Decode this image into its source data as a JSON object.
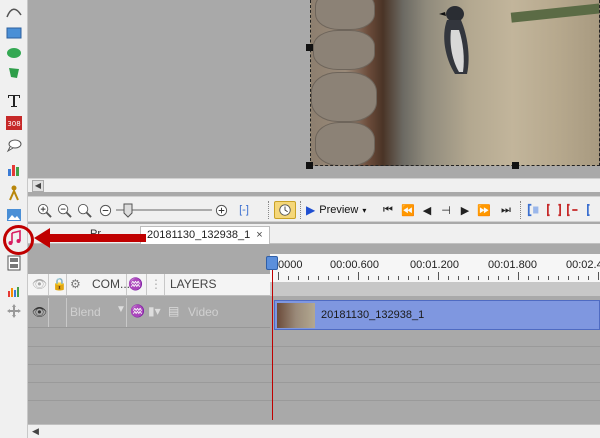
{
  "tools": [
    {
      "name": "curve-tool-icon",
      "glyph": "∿"
    },
    {
      "name": "rectangle-tool-icon",
      "glyph": "▭"
    },
    {
      "name": "ellipse-tool-icon",
      "glyph": "●"
    },
    {
      "name": "shape-tool-icon",
      "glyph": "✱"
    },
    {
      "name": "text-tool-icon",
      "glyph": "T"
    },
    {
      "name": "counter-tool-icon",
      "glyph": "308"
    },
    {
      "name": "callout-tool-icon",
      "glyph": "💬"
    },
    {
      "name": "chart-tool-icon",
      "glyph": "▥"
    },
    {
      "name": "figure-tool-icon",
      "glyph": "♙"
    },
    {
      "name": "image-tool-icon",
      "glyph": "▦"
    },
    {
      "name": "audio-tool-icon",
      "glyph": "♫"
    },
    {
      "name": "filmstrip-tool-icon",
      "glyph": "▤"
    },
    {
      "name": "equalizer-tool-icon",
      "glyph": "▥"
    },
    {
      "name": "move-tool-icon",
      "glyph": "✥"
    }
  ],
  "toolbar": {
    "preview_label": "Preview",
    "fit_label": "[-]"
  },
  "tabs": {
    "previous_label": "Pr",
    "active_label": "20181130_132938_1",
    "close_glyph": "×"
  },
  "layers": {
    "header_composite": "COM...",
    "header_layers": "LAYERS",
    "row": {
      "blend_mode": "Blend",
      "layer_name": "Video"
    }
  },
  "timeline": {
    "ticks": [
      "0000",
      "00:00.600",
      "00:01.200",
      "00:01.800",
      "00:02.4"
    ],
    "clip_label": "20181130_132938_1"
  },
  "colors": {
    "annotation_red": "#c00000",
    "clip_blue": "#7f97e0",
    "playhead_blue": "#5b8fdc"
  }
}
